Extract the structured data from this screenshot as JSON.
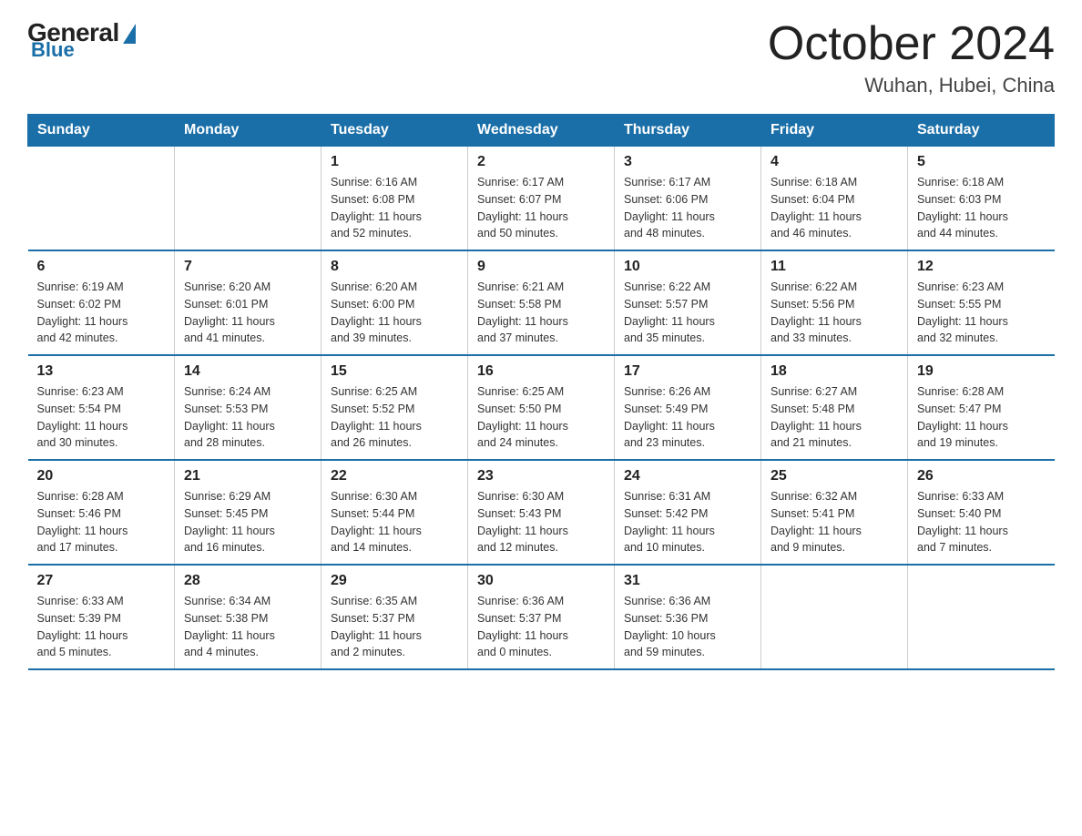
{
  "header": {
    "logo_general": "General",
    "logo_blue": "Blue",
    "month_title": "October 2024",
    "location": "Wuhan, Hubei, China"
  },
  "days_of_week": [
    "Sunday",
    "Monday",
    "Tuesday",
    "Wednesday",
    "Thursday",
    "Friday",
    "Saturday"
  ],
  "weeks": [
    [
      {
        "day": "",
        "info": ""
      },
      {
        "day": "",
        "info": ""
      },
      {
        "day": "1",
        "info": "Sunrise: 6:16 AM\nSunset: 6:08 PM\nDaylight: 11 hours\nand 52 minutes."
      },
      {
        "day": "2",
        "info": "Sunrise: 6:17 AM\nSunset: 6:07 PM\nDaylight: 11 hours\nand 50 minutes."
      },
      {
        "day": "3",
        "info": "Sunrise: 6:17 AM\nSunset: 6:06 PM\nDaylight: 11 hours\nand 48 minutes."
      },
      {
        "day": "4",
        "info": "Sunrise: 6:18 AM\nSunset: 6:04 PM\nDaylight: 11 hours\nand 46 minutes."
      },
      {
        "day": "5",
        "info": "Sunrise: 6:18 AM\nSunset: 6:03 PM\nDaylight: 11 hours\nand 44 minutes."
      }
    ],
    [
      {
        "day": "6",
        "info": "Sunrise: 6:19 AM\nSunset: 6:02 PM\nDaylight: 11 hours\nand 42 minutes."
      },
      {
        "day": "7",
        "info": "Sunrise: 6:20 AM\nSunset: 6:01 PM\nDaylight: 11 hours\nand 41 minutes."
      },
      {
        "day": "8",
        "info": "Sunrise: 6:20 AM\nSunset: 6:00 PM\nDaylight: 11 hours\nand 39 minutes."
      },
      {
        "day": "9",
        "info": "Sunrise: 6:21 AM\nSunset: 5:58 PM\nDaylight: 11 hours\nand 37 minutes."
      },
      {
        "day": "10",
        "info": "Sunrise: 6:22 AM\nSunset: 5:57 PM\nDaylight: 11 hours\nand 35 minutes."
      },
      {
        "day": "11",
        "info": "Sunrise: 6:22 AM\nSunset: 5:56 PM\nDaylight: 11 hours\nand 33 minutes."
      },
      {
        "day": "12",
        "info": "Sunrise: 6:23 AM\nSunset: 5:55 PM\nDaylight: 11 hours\nand 32 minutes."
      }
    ],
    [
      {
        "day": "13",
        "info": "Sunrise: 6:23 AM\nSunset: 5:54 PM\nDaylight: 11 hours\nand 30 minutes."
      },
      {
        "day": "14",
        "info": "Sunrise: 6:24 AM\nSunset: 5:53 PM\nDaylight: 11 hours\nand 28 minutes."
      },
      {
        "day": "15",
        "info": "Sunrise: 6:25 AM\nSunset: 5:52 PM\nDaylight: 11 hours\nand 26 minutes."
      },
      {
        "day": "16",
        "info": "Sunrise: 6:25 AM\nSunset: 5:50 PM\nDaylight: 11 hours\nand 24 minutes."
      },
      {
        "day": "17",
        "info": "Sunrise: 6:26 AM\nSunset: 5:49 PM\nDaylight: 11 hours\nand 23 minutes."
      },
      {
        "day": "18",
        "info": "Sunrise: 6:27 AM\nSunset: 5:48 PM\nDaylight: 11 hours\nand 21 minutes."
      },
      {
        "day": "19",
        "info": "Sunrise: 6:28 AM\nSunset: 5:47 PM\nDaylight: 11 hours\nand 19 minutes."
      }
    ],
    [
      {
        "day": "20",
        "info": "Sunrise: 6:28 AM\nSunset: 5:46 PM\nDaylight: 11 hours\nand 17 minutes."
      },
      {
        "day": "21",
        "info": "Sunrise: 6:29 AM\nSunset: 5:45 PM\nDaylight: 11 hours\nand 16 minutes."
      },
      {
        "day": "22",
        "info": "Sunrise: 6:30 AM\nSunset: 5:44 PM\nDaylight: 11 hours\nand 14 minutes."
      },
      {
        "day": "23",
        "info": "Sunrise: 6:30 AM\nSunset: 5:43 PM\nDaylight: 11 hours\nand 12 minutes."
      },
      {
        "day": "24",
        "info": "Sunrise: 6:31 AM\nSunset: 5:42 PM\nDaylight: 11 hours\nand 10 minutes."
      },
      {
        "day": "25",
        "info": "Sunrise: 6:32 AM\nSunset: 5:41 PM\nDaylight: 11 hours\nand 9 minutes."
      },
      {
        "day": "26",
        "info": "Sunrise: 6:33 AM\nSunset: 5:40 PM\nDaylight: 11 hours\nand 7 minutes."
      }
    ],
    [
      {
        "day": "27",
        "info": "Sunrise: 6:33 AM\nSunset: 5:39 PM\nDaylight: 11 hours\nand 5 minutes."
      },
      {
        "day": "28",
        "info": "Sunrise: 6:34 AM\nSunset: 5:38 PM\nDaylight: 11 hours\nand 4 minutes."
      },
      {
        "day": "29",
        "info": "Sunrise: 6:35 AM\nSunset: 5:37 PM\nDaylight: 11 hours\nand 2 minutes."
      },
      {
        "day": "30",
        "info": "Sunrise: 6:36 AM\nSunset: 5:37 PM\nDaylight: 11 hours\nand 0 minutes."
      },
      {
        "day": "31",
        "info": "Sunrise: 6:36 AM\nSunset: 5:36 PM\nDaylight: 10 hours\nand 59 minutes."
      },
      {
        "day": "",
        "info": ""
      },
      {
        "day": "",
        "info": ""
      }
    ]
  ]
}
